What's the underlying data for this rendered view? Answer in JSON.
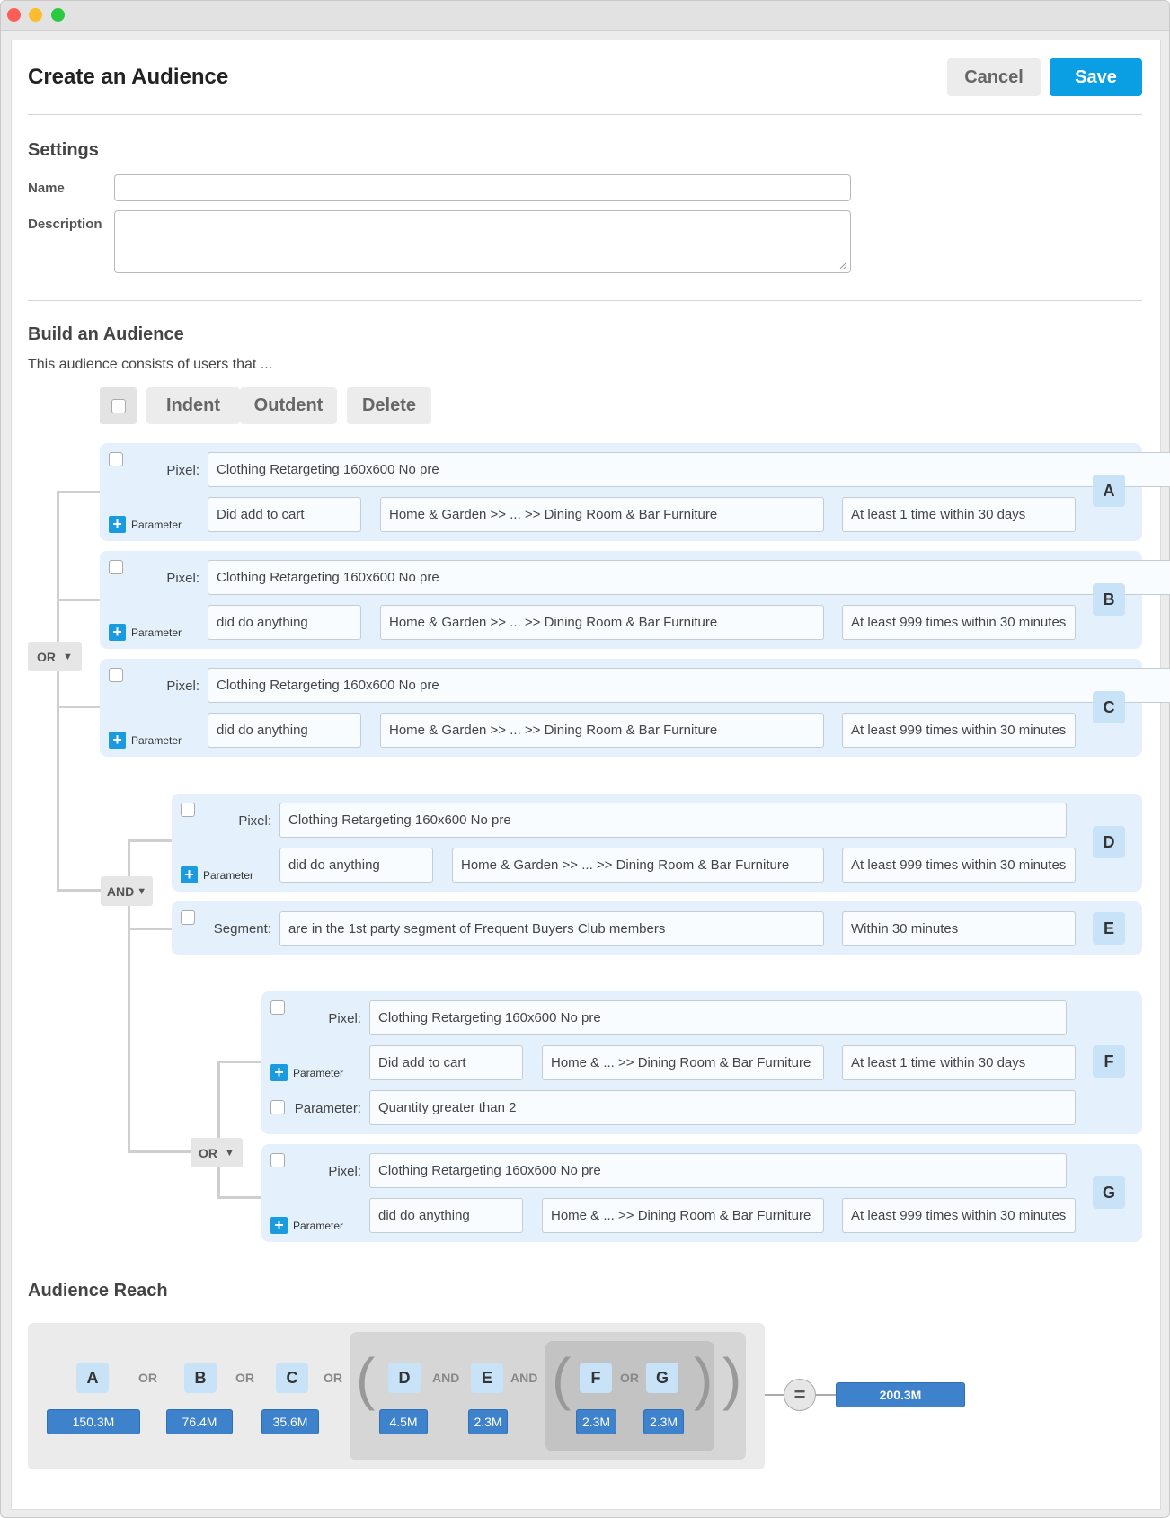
{
  "header": {
    "title": "Create an Audience",
    "cancel_label": "Cancel",
    "save_label": "Save"
  },
  "settings": {
    "heading": "Settings",
    "name_label": "Name",
    "description_label": "Description",
    "name_value": "",
    "description_value": ""
  },
  "build": {
    "heading": "Build an Audience",
    "intro": "This audience consists of users that ...",
    "toolbar": {
      "indent": "Indent",
      "outdent": "Outdent",
      "delete": "Delete"
    },
    "ops": {
      "top_or": "OR",
      "and": "AND",
      "inner_or": "OR"
    },
    "pixel_label": "Pixel:",
    "segment_label": "Segment:",
    "param_label": "Parameter:",
    "param_add": "Parameter",
    "rules": [
      {
        "letter": "A",
        "pixel": "Clothing Retargeting 160x600 No pre",
        "action": "Did add to cart",
        "category": "Home & Garden >> ... >> Dining Room & Bar Furniture",
        "freq": "At least 1 time within 30 days"
      },
      {
        "letter": "B",
        "pixel": "Clothing Retargeting 160x600 No pre",
        "action": "did do anything",
        "category": "Home & Garden >> ... >> Dining Room & Bar Furniture",
        "freq": "At least 999 times within 30 minutes"
      },
      {
        "letter": "C",
        "pixel": "Clothing Retargeting 160x600 No pre",
        "action": "did do anything",
        "category": "Home & Garden >> ... >> Dining Room & Bar Furniture",
        "freq": "At least 999 times within 30 minutes"
      },
      {
        "letter": "D",
        "pixel": "Clothing Retargeting 160x600 No pre",
        "action": "did do anything",
        "category": "Home & Garden >> ... >> Dining Room & Bar Furniture",
        "freq": "At least 999 times within 30 minutes"
      },
      {
        "letter": "E",
        "segment": "are in the 1st party segment of Frequent Buyers Club members",
        "freq": "Within 30 minutes"
      },
      {
        "letter": "F",
        "pixel": "Clothing Retargeting 160x600 No pre",
        "action": "Did add to cart",
        "category": "Home & ... >> Dining Room & Bar Furniture",
        "freq": "At least 1 time within 30 days",
        "parameter": "Quantity greater than 2"
      },
      {
        "letter": "G",
        "pixel": "Clothing Retargeting 160x600 No pre",
        "action": "did do anything",
        "category": "Home & ... >> Dining Room & Bar Furniture",
        "freq": "At least 999 times within 30 minutes"
      }
    ]
  },
  "reach": {
    "heading": "Audience Reach",
    "items": [
      {
        "letter": "A",
        "value": "150.3M"
      },
      {
        "letter": "B",
        "value": "76.4M"
      },
      {
        "letter": "C",
        "value": "35.6M"
      },
      {
        "letter": "D",
        "value": "4.5M"
      },
      {
        "letter": "E",
        "value": "2.3M"
      },
      {
        "letter": "F",
        "value": "2.3M"
      },
      {
        "letter": "G",
        "value": "2.3M"
      }
    ],
    "ops": {
      "or": "OR",
      "and": "AND",
      "equals": "="
    },
    "total": "200.3M"
  }
}
